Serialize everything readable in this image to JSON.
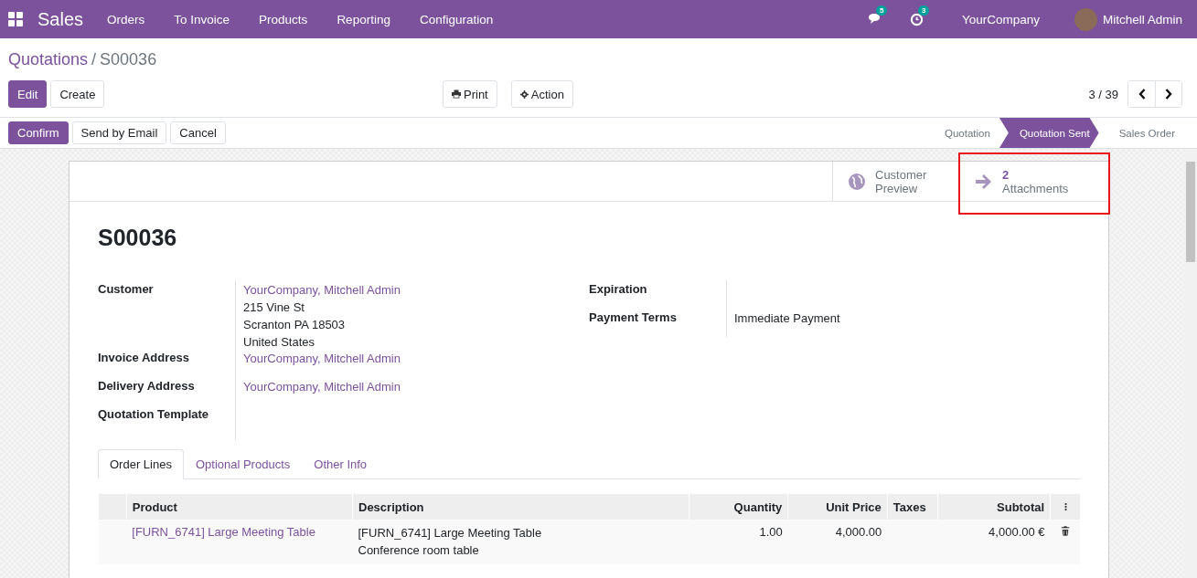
{
  "navbar": {
    "app": "Sales",
    "menu": [
      "Orders",
      "To Invoice",
      "Products",
      "Reporting",
      "Configuration"
    ],
    "messages_count": "5",
    "activities_count": "3",
    "company": "YourCompany",
    "user": "Mitchell Admin"
  },
  "breadcrumb": {
    "parent": "Quotations",
    "separator": "/",
    "current": "S00036"
  },
  "main_buttons": [
    {
      "label": "Edit",
      "kind": "primary"
    },
    {
      "label": "Create",
      "kind": "secondary"
    }
  ],
  "report_buttons": [
    {
      "label": "Print",
      "kind": "print"
    },
    {
      "label": "Action",
      "kind": "action"
    }
  ],
  "pager": "3 / 39",
  "status_buttons": [
    {
      "label": "Confirm",
      "kind": "primary"
    },
    {
      "label": "Send by Email",
      "kind": "secondary"
    },
    {
      "label": "Cancel",
      "kind": "secondary"
    }
  ],
  "stages": [
    {
      "label": "Quotation",
      "selected": false
    },
    {
      "label": "Quotation Sent",
      "selected": true
    },
    {
      "label": "Sales Order",
      "selected": false
    }
  ],
  "smart_buttons": [
    {
      "kind": "preview",
      "line1": "Customer",
      "line2": "Preview",
      "highlighted": false
    },
    {
      "kind": "attachments",
      "line1": "2",
      "line2": "Attachments",
      "highlighted": true
    }
  ],
  "title": "S00036",
  "left_fields": [
    {
      "label": "Customer",
      "value": "YourCompany, Mitchell Admin",
      "link": true,
      "extra": [
        "215 Vine St",
        "Scranton PA 18503",
        "United States"
      ]
    },
    {
      "label": "Invoice Address",
      "value": "YourCompany, Mitchell Admin",
      "link": true
    },
    {
      "label": "Delivery Address",
      "value": "YourCompany, Mitchell Admin",
      "link": true
    },
    {
      "label": "Quotation Template"
    }
  ],
  "right_fields": [
    {
      "label": "Expiration"
    },
    {
      "label": "Payment Terms",
      "value": "Immediate Payment",
      "link": false
    }
  ],
  "tabs": [
    {
      "label": "Order Lines",
      "selected": true
    },
    {
      "label": "Optional Products",
      "selected": false
    },
    {
      "label": "Other Info",
      "selected": false
    }
  ],
  "table": {
    "columns": [
      "Product",
      "Description",
      "Quantity",
      "Unit Price",
      "Taxes",
      "Subtotal"
    ],
    "rows": [
      {
        "product": "[FURN_6741] Large Meeting Table",
        "description": [
          "[FURN_6741] Large Meeting Table",
          "Conference room table"
        ],
        "quantity": "1.00",
        "unit_price": "4,000.00",
        "taxes": "",
        "subtotal": "4,000.00 €"
      }
    ]
  }
}
